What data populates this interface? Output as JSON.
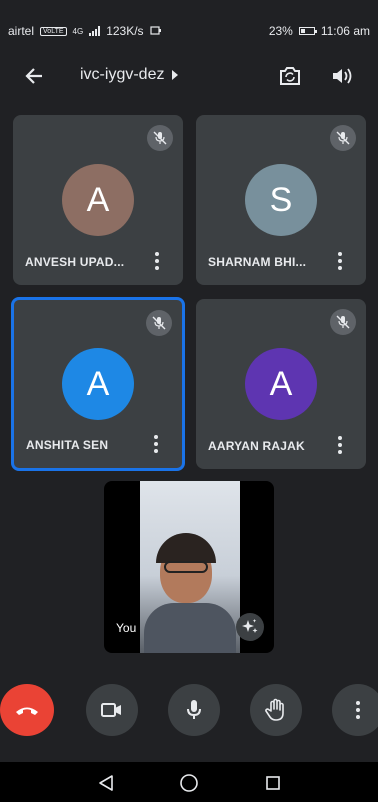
{
  "status_bar": {
    "carrier": "airtel",
    "volte": "VoLTE",
    "network": "4G",
    "speed": "123K/s",
    "battery": "23%",
    "time": "11:06 am"
  },
  "header": {
    "meeting_code": "ivc-iygv-dez"
  },
  "participants": [
    {
      "name": "ANVESH UPAD...",
      "initial": "A",
      "avatar_color": "#8d6e63",
      "active": false
    },
    {
      "name": "SHARNAM BHI...",
      "initial": "S",
      "avatar_color": "#78909c",
      "active": false
    },
    {
      "name": "ANSHITA SEN",
      "initial": "A",
      "avatar_color": "#1e88e5",
      "active": true
    },
    {
      "name": "AARYAN RAJAK",
      "initial": "A",
      "avatar_color": "#5e35b1",
      "active": false
    }
  ],
  "self_view": {
    "label": "You"
  },
  "icons": {
    "back": "arrow-back-icon",
    "dropdown": "caret-right-icon",
    "switch_camera": "switch-camera-icon",
    "speaker": "volume-icon",
    "mic_off": "mic-off-icon",
    "more": "more-vert-icon",
    "effects": "sparkles-icon",
    "end_call": "call-end-icon",
    "camera": "video-camera-icon",
    "mic": "mic-icon",
    "raise_hand": "raise-hand-icon",
    "nav_back": "nav-back-icon",
    "nav_home": "nav-home-icon",
    "nav_recents": "nav-recents-icon"
  },
  "colors": {
    "background": "#202124",
    "tile": "#3c4043",
    "active_border": "#1a73e8",
    "end_call": "#ea4335"
  }
}
